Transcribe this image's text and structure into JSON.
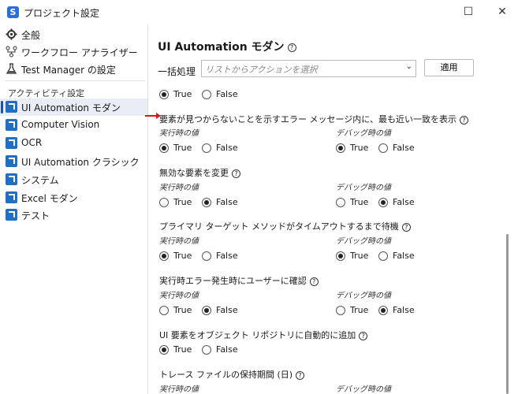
{
  "window": {
    "title": "プロジェクト設定",
    "app_icon": "S"
  },
  "sidebar": {
    "items": [
      {
        "label": "全般",
        "icon": "gear-icon"
      },
      {
        "label": "ワークフロー アナライザー",
        "icon": "workflow-analyzer-icon"
      },
      {
        "label": "Test Manager の設定",
        "icon": "flask-icon"
      }
    ],
    "section_label": "アクティビティ設定",
    "activity_items": [
      {
        "label": "UI Automation モダン",
        "selected": true
      },
      {
        "label": "Computer Vision"
      },
      {
        "label": "OCR"
      },
      {
        "label": "UI Automation クラシック"
      },
      {
        "label": "システム"
      },
      {
        "label": "Excel モダン"
      },
      {
        "label": "テスト"
      }
    ]
  },
  "main": {
    "title": "UI Automation モダン",
    "bulk_label": "一括処理",
    "select_placeholder": "リストからアクションを選択",
    "apply_label": "適用",
    "partial_row": {
      "true_label": "True",
      "false_label": "False",
      "selected": "True"
    },
    "settings": [
      {
        "title": "要素が見つからないことを示すエラー メッセージ内に、最も近い一致を表示",
        "runtime_label": "実行時の値",
        "debug_label": "デバッグ時の値",
        "runtime": "True",
        "debug": "True"
      },
      {
        "title": "無効な要素を変更",
        "runtime_label": "実行時の値",
        "debug_label": "デバッグ時の値",
        "runtime": "False",
        "debug": "False"
      },
      {
        "title": "プライマリ ターゲット メソッドがタイムアウトするまで待機",
        "runtime_label": "実行時の値",
        "debug_label": "デバッグ時の値",
        "runtime": "True",
        "debug": "True"
      },
      {
        "title": "実行時エラー発生時にユーザーに確認",
        "runtime_label": "実行時の値",
        "debug_label": "デバッグ時の値",
        "runtime": "False",
        "debug": "False"
      },
      {
        "title": "UI 要素をオブジェクト リポジトリに自動的に追加",
        "single": "True"
      },
      {
        "title": "トレース ファイルの保持期間 (日)",
        "runtime_label": "実行時の値",
        "debug_label": "デバッグ時の値"
      }
    ],
    "true_label": "True",
    "false_label": "False"
  },
  "colors": {
    "accent": "#1f6fc4",
    "selection": "#e8edf6",
    "pointer": "#d21b1b"
  }
}
